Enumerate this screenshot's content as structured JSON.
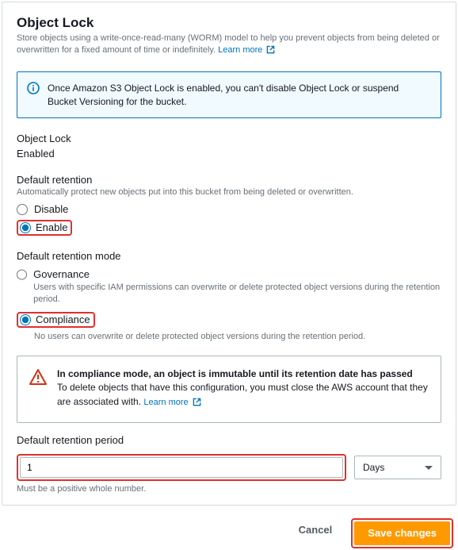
{
  "panel": {
    "title": "Object Lock",
    "description": "Store objects using a write-once-read-many (WORM) model to help you prevent objects from being deleted or overwritten for a fixed amount of time or indefinitely.",
    "learn_more": "Learn more"
  },
  "info_notice": "Once Amazon S3 Object Lock is enabled, you can't disable Object Lock or suspend Bucket Versioning for the bucket.",
  "status": {
    "label": "Object Lock",
    "value": "Enabled"
  },
  "default_retention": {
    "label": "Default retention",
    "desc": "Automatically protect new objects put into this bucket from being deleted or overwritten.",
    "options": {
      "disable": "Disable",
      "enable": "Enable"
    }
  },
  "retention_mode": {
    "label": "Default retention mode",
    "governance": {
      "label": "Governance",
      "desc": "Users with specific IAM permissions can overwrite or delete protected object versions during the retention period."
    },
    "compliance": {
      "label": "Compliance",
      "desc": "No users can overwrite or delete protected object versions during the retention period."
    }
  },
  "compliance_warning": {
    "title": "In compliance mode, an object is immutable until its retention date has passed",
    "body": "To delete objects that have this configuration, you must close the AWS account that they are associated with.",
    "learn_more": "Learn more"
  },
  "retention_period": {
    "label": "Default retention period",
    "value": "1",
    "unit": "Days",
    "help": "Must be a positive whole number."
  },
  "footer": {
    "cancel": "Cancel",
    "save": "Save changes"
  },
  "colors": {
    "accent": "#0073bb",
    "primary_button": "#ff9900",
    "highlight": "#e03030"
  }
}
